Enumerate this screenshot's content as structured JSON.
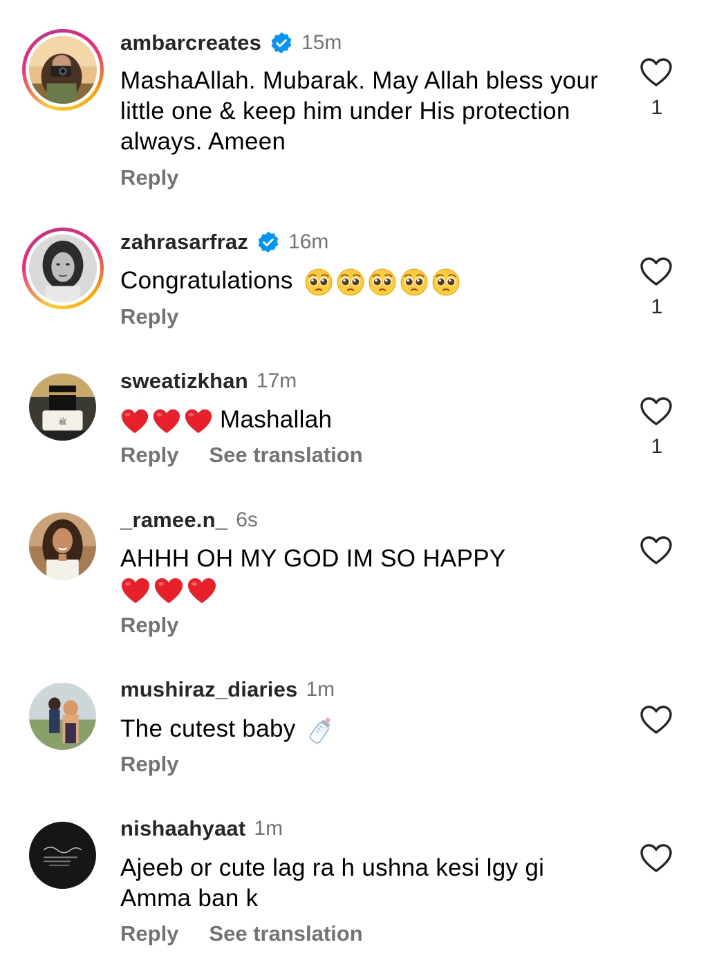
{
  "colors": {
    "username": "#262626",
    "secondary": "#737373",
    "verified": "#0095f6",
    "heart": "#e8202a"
  },
  "comments": [
    {
      "username": "ambarcreates",
      "verified": true,
      "time": "15m",
      "text": "MashaAllah. Mubarak. May Allah bless your little one & keep him under His protection always. Ameen",
      "reply_label": "Reply",
      "like_count": "1",
      "story_ring": true,
      "like_icon": "heart-outline-icon"
    },
    {
      "username": "zahrasarfraz",
      "verified": true,
      "time": "16m",
      "text": "Congratulations",
      "emojis": [
        "pleading-face",
        "pleading-face",
        "pleading-face",
        "pleading-face",
        "pleading-face"
      ],
      "reply_label": "Reply",
      "like_count": "1",
      "story_ring": true,
      "like_icon": "heart-outline-icon"
    },
    {
      "username": "sweatizkhan",
      "verified": false,
      "time": "17m",
      "text": "Mashallah",
      "emojis": [
        "red-heart",
        "red-heart",
        "red-heart"
      ],
      "reply_label": "Reply",
      "translate_label": "See translation",
      "like_count": "1",
      "story_ring": false,
      "like_icon": "heart-outline-icon"
    },
    {
      "username": "_ramee.n_",
      "verified": false,
      "time": "6s",
      "text": "AHHH OH MY GOD IM SO HAPPY",
      "emojis": [
        "red-heart",
        "red-heart",
        "red-heart"
      ],
      "reply_label": "Reply",
      "story_ring": false,
      "like_icon": "heart-outline-icon"
    },
    {
      "username": "mushiraz_diaries",
      "verified": false,
      "time": "1m",
      "text": "The cutest baby",
      "emojis": [
        "baby-bottle"
      ],
      "reply_label": "Reply",
      "story_ring": false,
      "like_icon": "heart-outline-icon"
    },
    {
      "username": "nishaahyaat",
      "verified": false,
      "time": "1m",
      "text": "Ajeeb or cute lag ra h ushna kesi lgy gi Amma ban k",
      "reply_label": "Reply",
      "translate_label": "See translation",
      "story_ring": false,
      "like_icon": "heart-outline-icon"
    }
  ]
}
